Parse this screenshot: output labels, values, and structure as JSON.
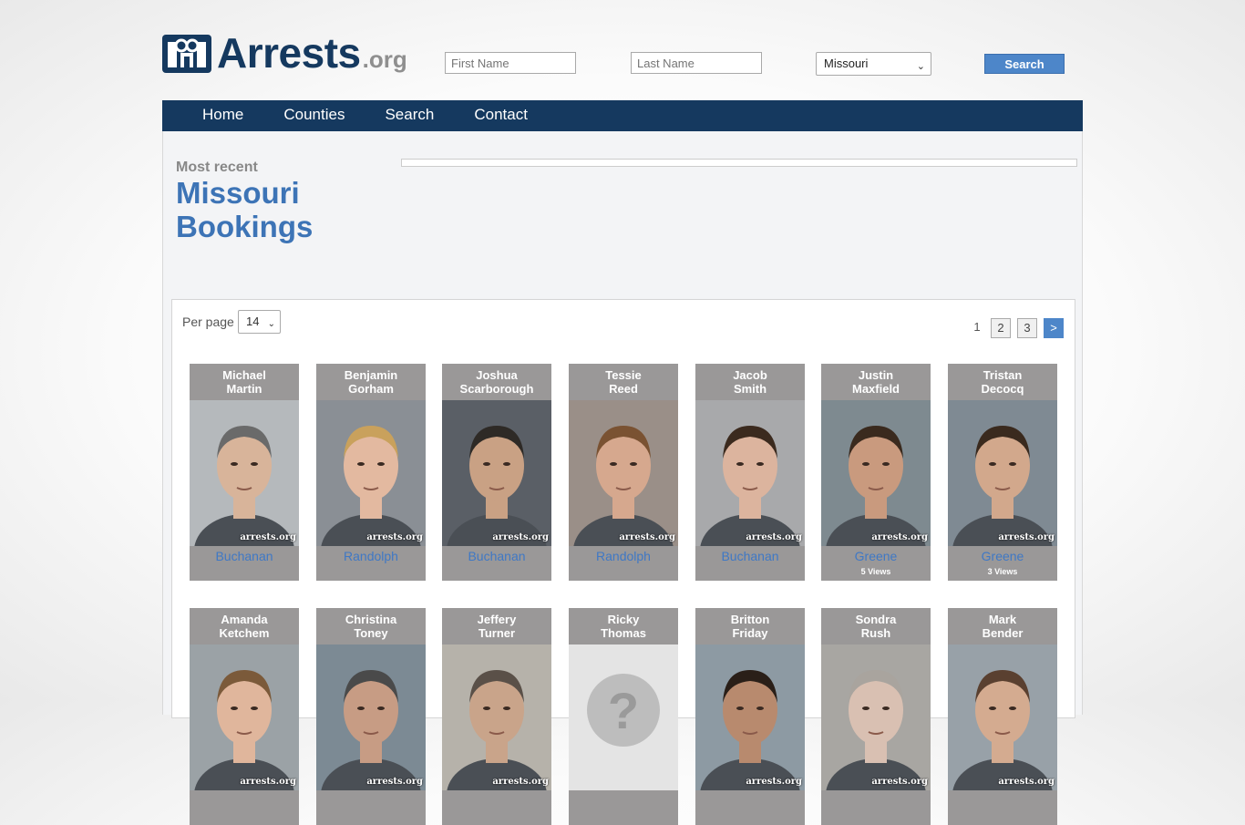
{
  "header": {
    "logo_main": "Arrests",
    "logo_tld": ".org",
    "first_name_placeholder": "First Name",
    "last_name_placeholder": "Last Name",
    "state_selected": "Missouri",
    "search_label": "Search"
  },
  "nav": [
    "Home",
    "Counties",
    "Search",
    "Contact"
  ],
  "page": {
    "eyebrow": "Most recent",
    "title_line1": "Missouri",
    "title_line2": "Bookings"
  },
  "listing": {
    "per_page_label": "Per page",
    "per_page_value": "14",
    "pages": [
      "1",
      "2",
      "3",
      ">"
    ],
    "watermark": "arrests.org",
    "cards": [
      {
        "first": "Michael",
        "last": "Martin",
        "county": "Buchanan",
        "views": ""
      },
      {
        "first": "Benjamin",
        "last": "Gorham",
        "county": "Randolph",
        "views": ""
      },
      {
        "first": "Joshua",
        "last": "Scarborough",
        "county": "Buchanan",
        "views": ""
      },
      {
        "first": "Tessie",
        "last": "Reed",
        "county": "Randolph",
        "views": ""
      },
      {
        "first": "Jacob",
        "last": "Smith",
        "county": "Buchanan",
        "views": ""
      },
      {
        "first": "Justin",
        "last": "Maxfield",
        "county": "Greene",
        "views": "5 Views"
      },
      {
        "first": "Tristan",
        "last": "Decocq",
        "county": "Greene",
        "views": "3 Views"
      },
      {
        "first": "Amanda",
        "last": "Ketchem",
        "county": "",
        "views": ""
      },
      {
        "first": "Christina",
        "last": "Toney",
        "county": "",
        "views": ""
      },
      {
        "first": "Jeffery",
        "last": "Turner",
        "county": "",
        "views": ""
      },
      {
        "first": "Ricky",
        "last": "Thomas",
        "county": "",
        "views": ""
      },
      {
        "first": "Britton",
        "last": "Friday",
        "county": "",
        "views": ""
      },
      {
        "first": "Sondra",
        "last": "Rush",
        "county": "",
        "views": ""
      },
      {
        "first": "Mark",
        "last": "Bender",
        "county": "",
        "views": ""
      }
    ]
  },
  "colors": {
    "brand_navy": "#15395f",
    "accent_blue": "#4d86c9",
    "link_blue": "#3f78c5",
    "card_gray": "#9a9898"
  }
}
